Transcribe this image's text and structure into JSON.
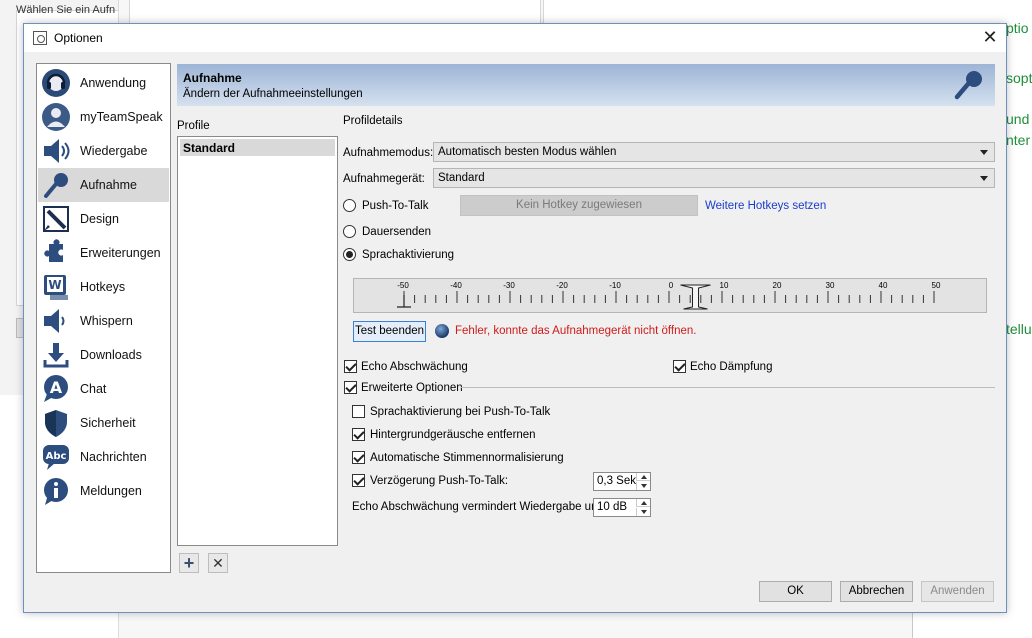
{
  "background": {
    "hint_text": "Wählen Sie ein Aufn",
    "right_texts": [
      "ptio",
      "sopt",
      "und",
      "nter",
      "tellu"
    ]
  },
  "dialog": {
    "title": "Optionen",
    "close_glyph": "✕"
  },
  "sidebar": {
    "items": [
      {
        "label": "Anwendung",
        "icon": "headset-icon",
        "selected": false
      },
      {
        "label": "myTeamSpeak",
        "icon": "user-icon",
        "selected": false
      },
      {
        "label": "Wiedergabe",
        "icon": "speaker-icon",
        "selected": false
      },
      {
        "label": "Aufnahme",
        "icon": "microphone-icon",
        "selected": true
      },
      {
        "label": "Design",
        "icon": "design-icon",
        "selected": false
      },
      {
        "label": "Erweiterungen",
        "icon": "puzzle-icon",
        "selected": false
      },
      {
        "label": "Hotkeys",
        "icon": "keyboard-icon",
        "selected": false
      },
      {
        "label": "Whispern",
        "icon": "whisper-icon",
        "selected": false
      },
      {
        "label": "Downloads",
        "icon": "download-icon",
        "selected": false
      },
      {
        "label": "Chat",
        "icon": "chat-icon",
        "selected": false
      },
      {
        "label": "Sicherheit",
        "icon": "shield-icon",
        "selected": false
      },
      {
        "label": "Nachrichten",
        "icon": "message-icon",
        "selected": false
      },
      {
        "label": "Meldungen",
        "icon": "info-icon",
        "selected": false
      }
    ]
  },
  "header": {
    "title": "Aufnahme",
    "subtitle": "Ändern der Aufnahmeeinstellungen"
  },
  "profiles": {
    "label": "Profile",
    "items": [
      "Standard"
    ],
    "add_glyph": "+",
    "remove_glyph": "✕"
  },
  "details": {
    "group_label": "Profildetails",
    "mode_label": "Aufnahmemodus:",
    "mode_value": "Automatisch besten Modus wählen",
    "device_label": "Aufnahmegerät:",
    "device_value": "Standard",
    "ptt_label": "Push-To-Talk",
    "hotkey_button": "Kein Hotkey zugewiesen",
    "more_hotkeys_link": "Weitere Hotkeys setzen",
    "continuous_label": "Dauersenden",
    "vad_label": "Sprachaktivierung",
    "selected_mode": "Sprachaktivierung",
    "meter": {
      "ticks": [
        "-50",
        "-40",
        "-30",
        "-20",
        "-10",
        "0",
        "10",
        "20",
        "30",
        "40",
        "50"
      ],
      "threshold": 5,
      "current": -50
    },
    "test_button": "Test beenden",
    "error_text": "Fehler, konnte das Aufnahmegerät nicht öffnen.",
    "echo_reduction": {
      "label": "Echo Abschwächung",
      "checked": true
    },
    "echo_cancel": {
      "label": "Echo Dämpfung",
      "checked": true
    },
    "advanced": {
      "label": "Erweiterte Optionen",
      "checked": true
    },
    "adv_options": [
      {
        "label": "Sprachaktivierung bei Push-To-Talk",
        "checked": false
      },
      {
        "label": "Hintergrundgeräusche entfernen",
        "checked": true
      },
      {
        "label": "Automatische Stimmennormalisierung",
        "checked": true
      },
      {
        "label": "Verzögerung Push-To-Talk:",
        "checked": true
      }
    ],
    "ptt_delay_value": "0,3 Sek",
    "echo_playback_label": "Echo Abschwächung vermindert Wiedergabe um:",
    "echo_playback_value": "10 dB"
  },
  "buttons": {
    "ok": "OK",
    "cancel": "Abbrechen",
    "apply": "Anwenden"
  }
}
